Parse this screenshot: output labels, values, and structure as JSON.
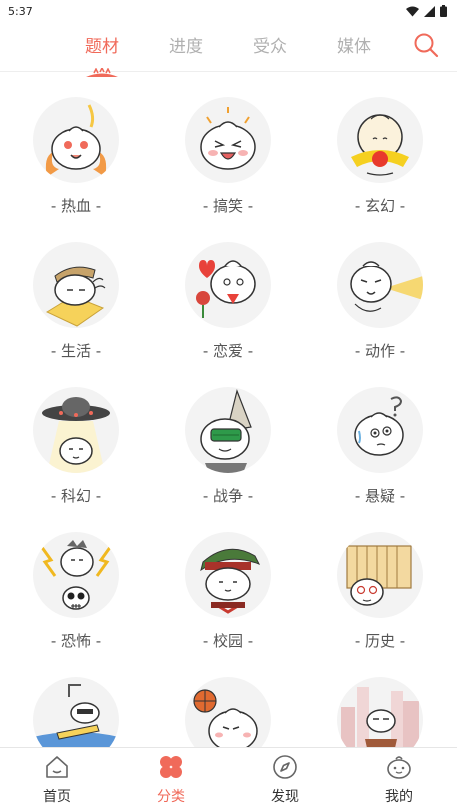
{
  "status": {
    "time": "5:37"
  },
  "tabs": [
    {
      "label": "题材"
    },
    {
      "label": "进度"
    },
    {
      "label": "受众"
    },
    {
      "label": "媒体"
    }
  ],
  "categories": [
    {
      "label": "- 热血 -",
      "icon": "hot-blood-mascot-icon"
    },
    {
      "label": "- 搞笑 -",
      "icon": "comedy-mascot-icon"
    },
    {
      "label": "- 玄幻 -",
      "icon": "fantasy-mascot-icon"
    },
    {
      "label": "- 生活 -",
      "icon": "life-mascot-icon"
    },
    {
      "label": "- 恋爱 -",
      "icon": "romance-mascot-icon"
    },
    {
      "label": "- 动作 -",
      "icon": "action-mascot-icon"
    },
    {
      "label": "- 科幻 -",
      "icon": "scifi-mascot-icon"
    },
    {
      "label": "- 战争 -",
      "icon": "war-mascot-icon"
    },
    {
      "label": "- 悬疑 -",
      "icon": "mystery-mascot-icon"
    },
    {
      "label": "- 恐怖 -",
      "icon": "horror-mascot-icon"
    },
    {
      "label": "- 校园 -",
      "icon": "campus-mascot-icon"
    },
    {
      "label": "- 历史 -",
      "icon": "history-mascot-icon"
    },
    {
      "label": "",
      "icon": "sports-mascot-icon"
    },
    {
      "label": "",
      "icon": "basketball-mascot-icon"
    },
    {
      "label": "",
      "icon": "city-mascot-icon"
    }
  ],
  "bottom_nav": [
    {
      "label": "首页",
      "icon": "home-icon"
    },
    {
      "label": "分类",
      "icon": "category-icon"
    },
    {
      "label": "发现",
      "icon": "compass-icon"
    },
    {
      "label": "我的",
      "icon": "profile-icon"
    }
  ],
  "colors": {
    "accent": "#f06a5a",
    "inactive": "#b0b0b0"
  }
}
